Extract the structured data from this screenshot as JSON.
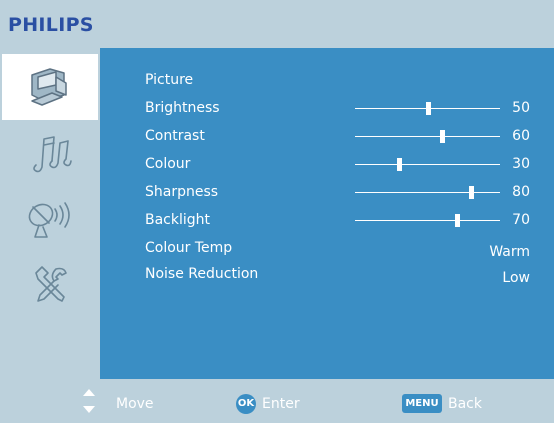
{
  "brand": "PHILIPS",
  "colors": {
    "panel": "#3a8ec4",
    "frame": "#bcd1dc",
    "brand": "#2a4fa3",
    "text": "#ffffff"
  },
  "sidebar": {
    "items": [
      {
        "icon": "picture-icon",
        "active": true
      },
      {
        "icon": "music-notes-icon",
        "active": false
      },
      {
        "icon": "satellite-dish-icon",
        "active": false
      },
      {
        "icon": "tools-icon",
        "active": false
      }
    ]
  },
  "menu": {
    "title": "Picture",
    "items": [
      {
        "label": "Brightness",
        "value": "50",
        "level": 50
      },
      {
        "label": "Contrast",
        "value": "60",
        "level": 60
      },
      {
        "label": "Colour",
        "value": "30",
        "level": 30
      },
      {
        "label": "Sharpness",
        "value": "80",
        "level": 80
      },
      {
        "label": "Backlight",
        "value": "70",
        "level": 70
      },
      {
        "label": "Colour Temp",
        "value": "Warm"
      },
      {
        "label": "Noise Reduction",
        "value": "Low"
      }
    ]
  },
  "footer": {
    "move": "Move",
    "ok_key": "OK",
    "enter": "Enter",
    "menu_key": "MENU",
    "back": "Back"
  }
}
